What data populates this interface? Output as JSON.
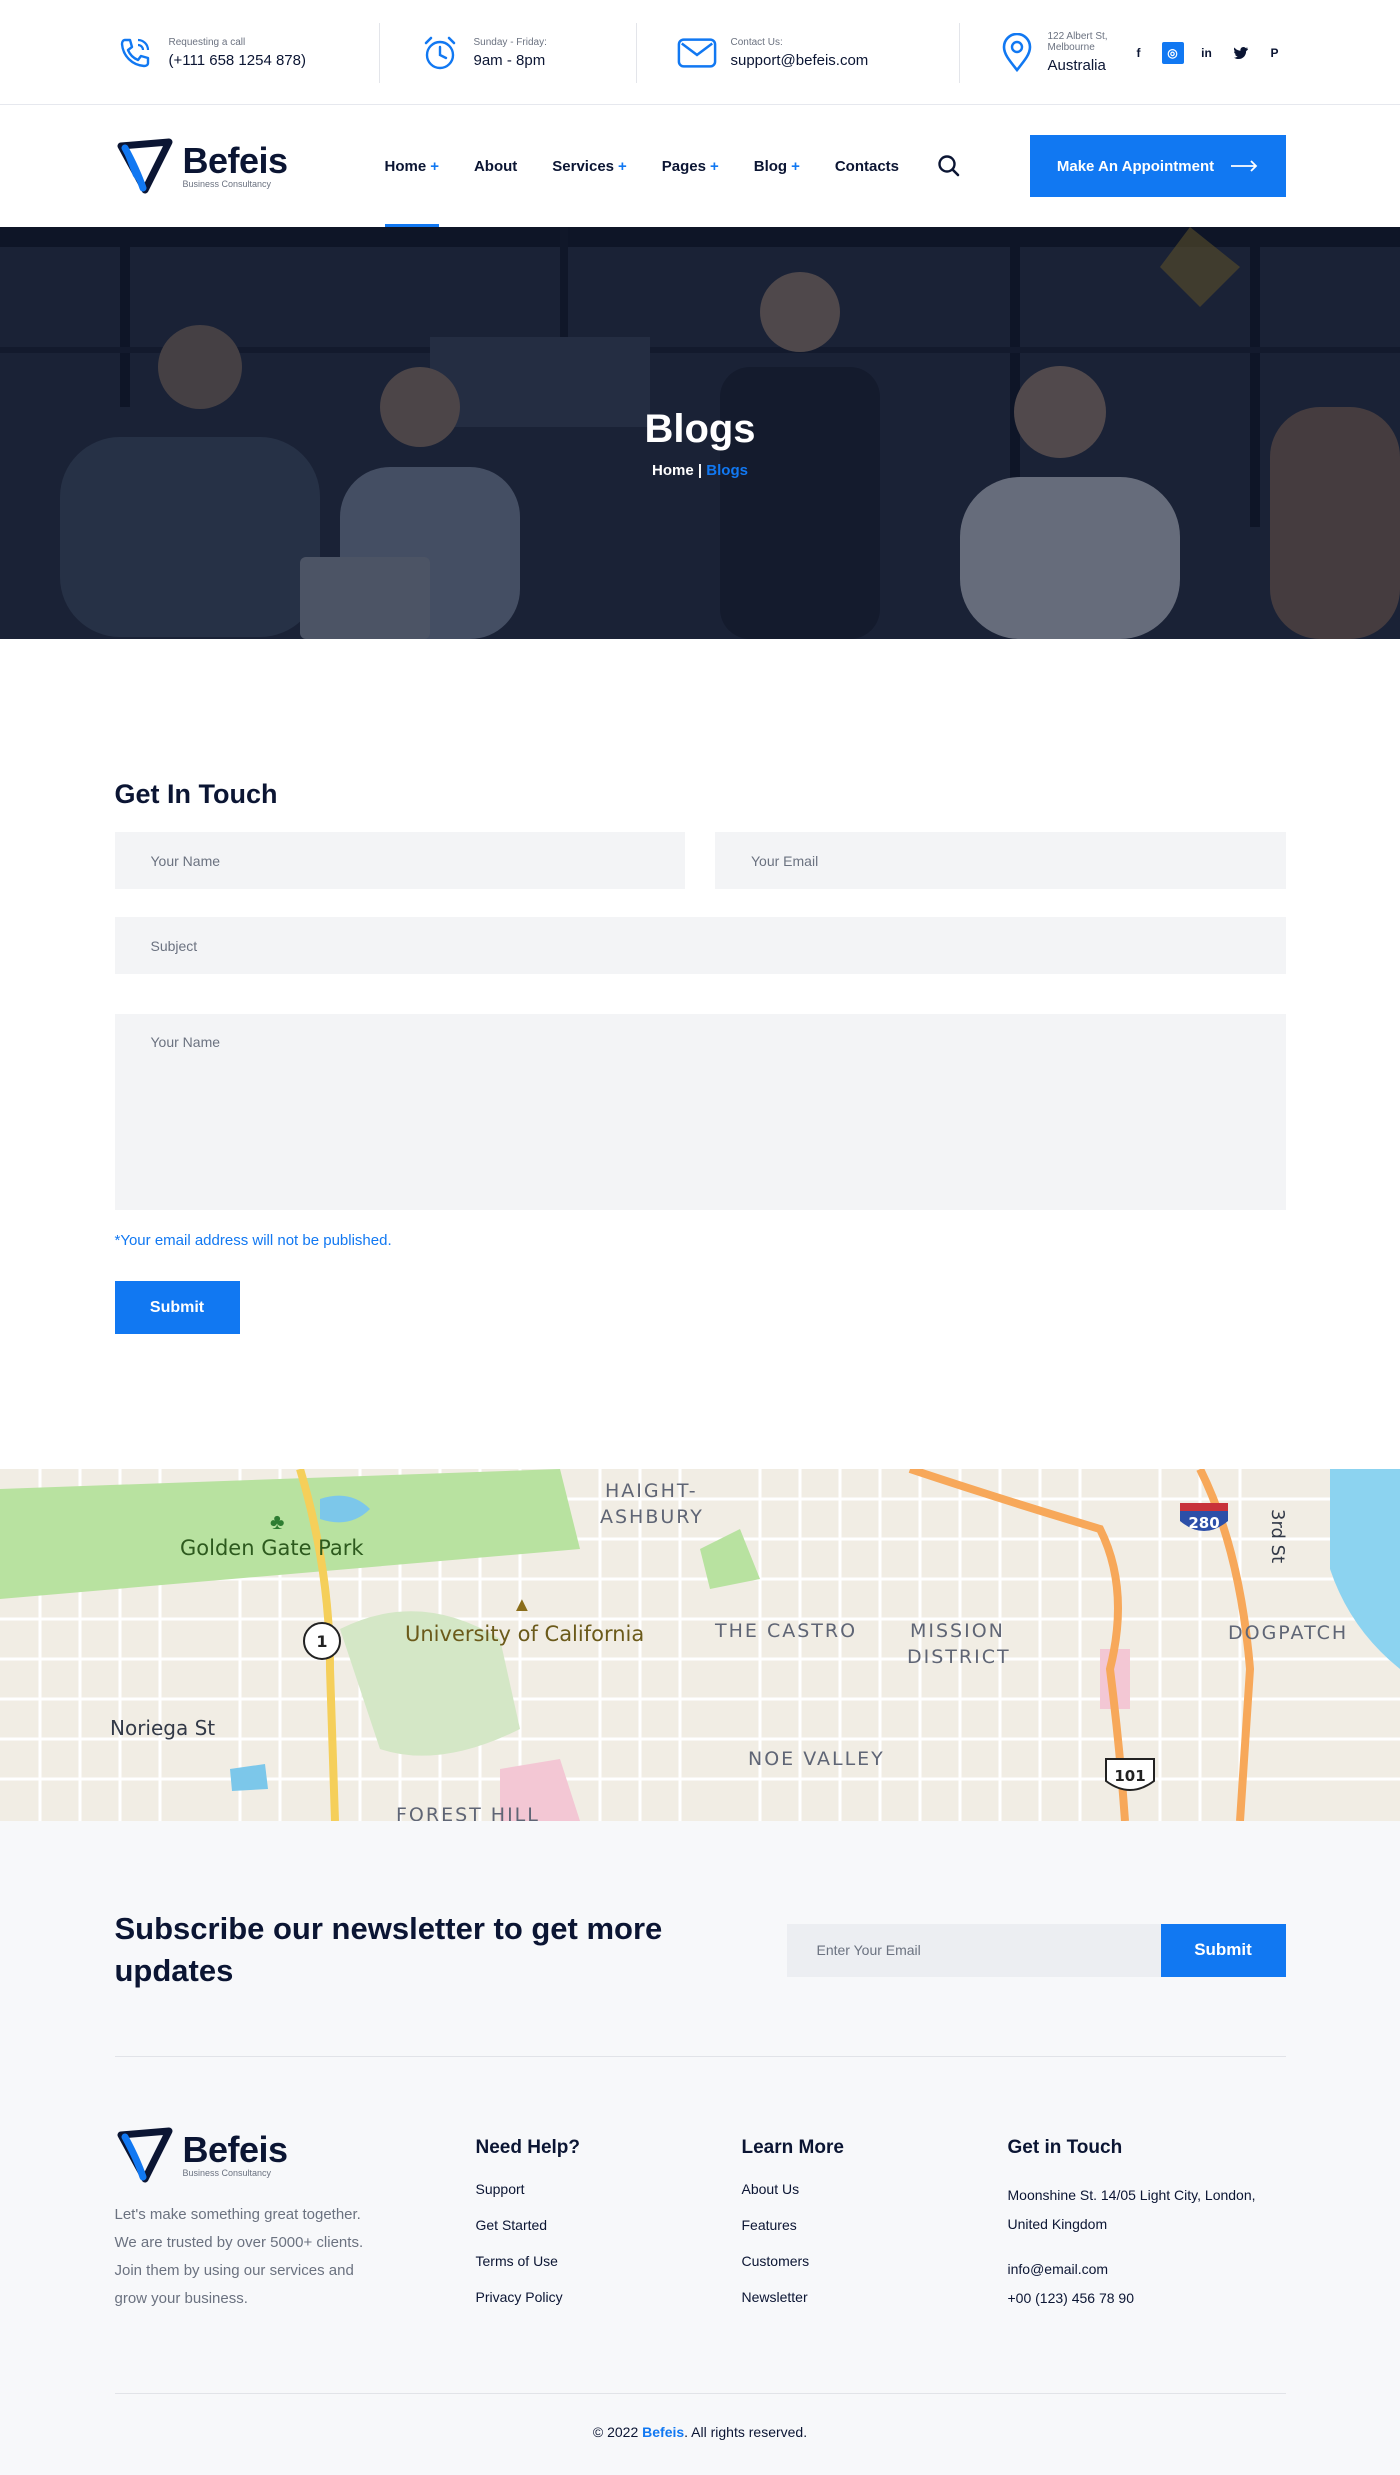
{
  "colors": {
    "accent": "#1178f2",
    "dark": "#0b1533",
    "muted": "#6b7280"
  },
  "topbar": {
    "call": {
      "label": "Requesting a call",
      "value": "(+111 658 1254 878)",
      "icon": "phone-icon"
    },
    "hours": {
      "label": "Sunday - Friday:",
      "value": "9am - 8pm",
      "icon": "clock-icon"
    },
    "email": {
      "label": "Contact Us:",
      "value": "support@befeis.com",
      "icon": "envelope-icon"
    },
    "location": {
      "label": "122 Albert St, Melbourne",
      "value": "Australia",
      "icon": "map-pin-icon"
    },
    "socials": [
      {
        "name": "facebook",
        "glyph": "f"
      },
      {
        "name": "dribbble",
        "glyph": "◎"
      },
      {
        "name": "linkedin",
        "glyph": "in"
      },
      {
        "name": "twitter",
        "glyph": "✓"
      },
      {
        "name": "pinterest",
        "glyph": "P"
      }
    ]
  },
  "header": {
    "logo": {
      "name": "Befeis",
      "tagline": "Business Consultancy"
    },
    "nav": [
      {
        "label": "Home",
        "plus": "+"
      },
      {
        "label": "About",
        "plus": ""
      },
      {
        "label": "Services",
        "plus": "+"
      },
      {
        "label": "Pages",
        "plus": "+"
      },
      {
        "label": "Blog",
        "plus": "+"
      },
      {
        "label": "Contacts",
        "plus": ""
      }
    ],
    "cta_label": "Make An Appointment"
  },
  "hero": {
    "title": "Blogs",
    "breadcrumb": {
      "home": "Home",
      "separator": " | ",
      "current": "Blogs"
    }
  },
  "form": {
    "title": "Get In Touch",
    "name_placeholder": "Your Name",
    "email_placeholder": "Your Email",
    "subject_placeholder": "Subject",
    "message_placeholder": "Your Name",
    "note": "*Your email address will not be published.",
    "submit_label": "Submit"
  },
  "map": {
    "labels": [
      "HAIGHT-ASHBURY",
      "Golden Gate Park",
      "University of California",
      "THE CASTRO",
      "MISSION DISTRICT",
      "DOGPATCH",
      "Noriega St",
      "NOE VALLEY",
      "FOREST HILL",
      "3rd St"
    ],
    "shields": [
      "1",
      "280",
      "101"
    ]
  },
  "newsletter": {
    "title": "Subscribe our newsletter to get more updates",
    "placeholder": "Enter Your Email",
    "button_label": "Submit"
  },
  "footer": {
    "about_text": "Let's make something great together. We are trusted by over 5000+ clients. Join them by using our services and grow your business.",
    "help": {
      "title": "Need Help?",
      "links": [
        "Support",
        "Get Started",
        "Terms of Use",
        "Privacy Policy"
      ]
    },
    "learn": {
      "title": "Learn More",
      "links": [
        "About Us",
        "Features",
        "Customers",
        "Newsletter"
      ]
    },
    "touch": {
      "title": "Get in Touch",
      "address_line1": "Moonshine St. 14/05 Light City, London,",
      "address_line2": "United Kingdom",
      "email": "info@email.com",
      "phone": "+00 (123) 456 78 90"
    },
    "copyright": {
      "prefix": "© 2022 ",
      "brand": "Befeis",
      "suffix": ". All rights reserved."
    }
  }
}
